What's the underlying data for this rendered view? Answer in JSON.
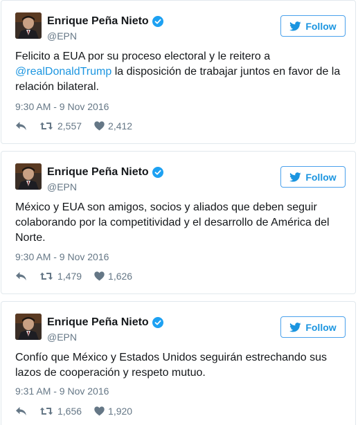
{
  "colors": {
    "link": "#1b95e0",
    "text": "#14171a",
    "muted": "#657786",
    "border": "#e1e8ed",
    "verified": "#1da1f2"
  },
  "icons": {
    "verified": "verified-badge-icon",
    "follow": "twitter-bird-icon",
    "reply": "reply-icon",
    "retweet": "retweet-icon",
    "like": "heart-icon"
  },
  "tweets": [
    {
      "name": "Enrique Peña Nieto",
      "handle": "@EPN",
      "follow_label": "Follow",
      "text_before": "Felicito a EUA por su proceso electoral y le reitero a ",
      "mention": "@realDonaldTrump",
      "text_after": " la disposición de trabajar juntos en favor de la relación bilateral.",
      "timestamp": "9:30 AM - 9 Nov 2016",
      "retweets": "2,557",
      "likes": "2,412"
    },
    {
      "name": "Enrique Peña Nieto",
      "handle": "@EPN",
      "follow_label": "Follow",
      "text_before": "México y EUA son amigos, socios y aliados que deben seguir colaborando por la competitividad y el desarrollo de América del Norte.",
      "mention": "",
      "text_after": "",
      "timestamp": "9:30 AM - 9 Nov 2016",
      "retweets": "1,479",
      "likes": "1,626"
    },
    {
      "name": "Enrique Peña Nieto",
      "handle": "@EPN",
      "follow_label": "Follow",
      "text_before": "Confío que México y Estados Unidos seguirán estrechando sus lazos de cooperación y respeto mutuo.",
      "mention": "",
      "text_after": "",
      "timestamp": "9:31 AM - 9 Nov 2016",
      "retweets": "1,656",
      "likes": "1,920"
    }
  ]
}
